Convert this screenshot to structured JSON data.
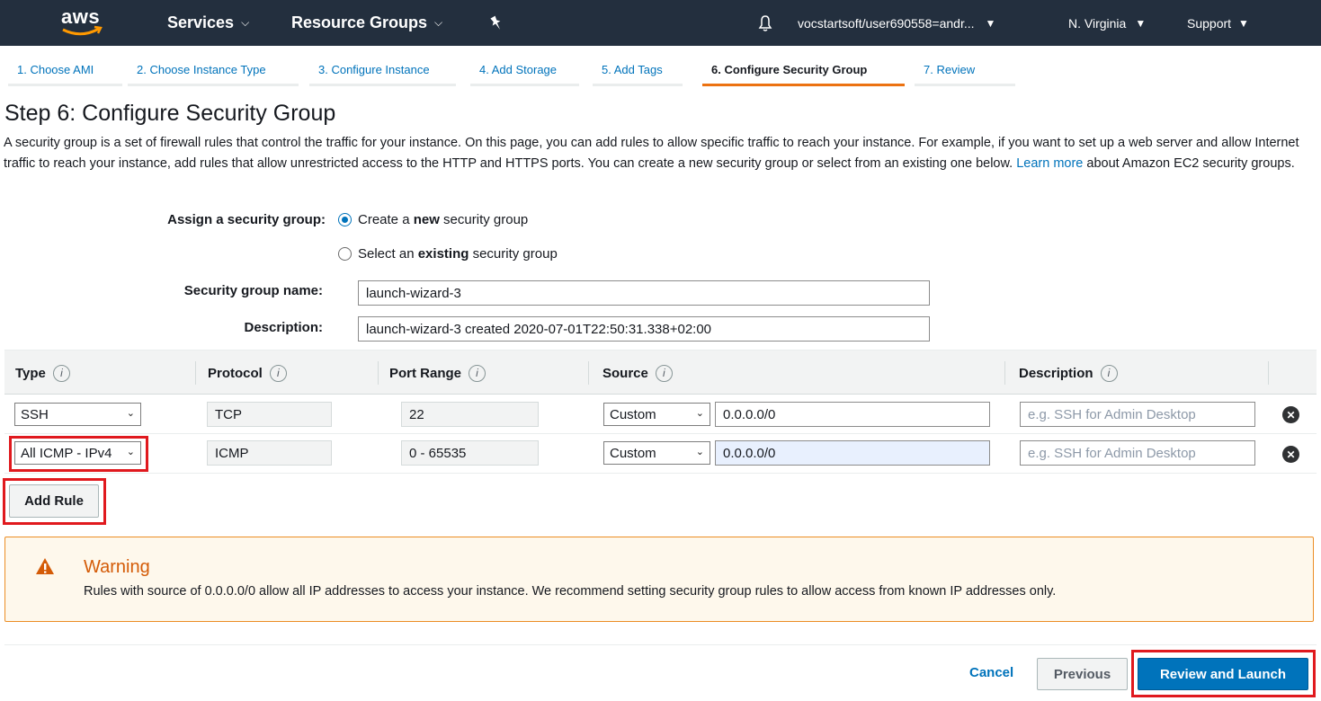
{
  "nav": {
    "logo": "aws",
    "services": "Services",
    "resource_groups": "Resource Groups",
    "account": "vocstartsoft/user690558=andr...",
    "region": "N. Virginia",
    "support": "Support"
  },
  "wizard": {
    "tabs": [
      "1. Choose AMI",
      "2. Choose Instance Type",
      "3. Configure Instance",
      "4. Add Storage",
      "5. Add Tags",
      "6. Configure Security Group",
      "7. Review"
    ],
    "active_index": 5
  },
  "page": {
    "title": "Step 6: Configure Security Group",
    "intro_before_link": "A security group is a set of firewall rules that control the traffic for your instance. On this page, you can add rules to allow specific traffic to reach your instance. For example, if you want to set up a web server and allow Internet traffic to reach your instance, add rules that allow unrestricted access to the HTTP and HTTPS ports. You can create a new security group or select from an existing one below.",
    "learn_more": "Learn more",
    "intro_after_link": "about Amazon EC2 security groups."
  },
  "assign": {
    "label": "Assign a security group:",
    "option_new_pre": "Create a ",
    "option_new_bold": "new",
    "option_new_post": " security group",
    "option_existing_pre": "Select an ",
    "option_existing_bold": "existing",
    "option_existing_post": " security group",
    "selected": "new"
  },
  "sg": {
    "name_label": "Security group name:",
    "name_value": "launch-wizard-3",
    "desc_label": "Description:",
    "desc_value": "launch-wizard-3 created 2020-07-01T22:50:31.338+02:00"
  },
  "table": {
    "headers": [
      "Type",
      "Protocol",
      "Port Range",
      "Source",
      "Description"
    ],
    "info_glyph": "i",
    "rows": [
      {
        "type": "SSH",
        "protocol": "TCP",
        "port": "22",
        "source_mode": "Custom",
        "source": "0.0.0.0/0",
        "description_placeholder": "e.g. SSH for Admin Desktop"
      },
      {
        "type": "All ICMP - IPv4",
        "protocol": "ICMP",
        "port": "0 - 65535",
        "source_mode": "Custom",
        "source": "0.0.0.0/0",
        "description_placeholder": "e.g. SSH for Admin Desktop"
      }
    ]
  },
  "add_rule": "Add Rule",
  "warning": {
    "title": "Warning",
    "message": "Rules with source of 0.0.0.0/0 allow all IP addresses to access your instance. We recommend setting security group rules to allow access from known IP addresses only."
  },
  "footer": {
    "cancel": "Cancel",
    "previous": "Previous",
    "review": "Review and Launch"
  },
  "colors": {
    "nav_bg": "#232f3e",
    "link": "#0073bb",
    "active_tab": "#ec7211",
    "highlight": "#e0191e",
    "warning": "#d45b07"
  }
}
